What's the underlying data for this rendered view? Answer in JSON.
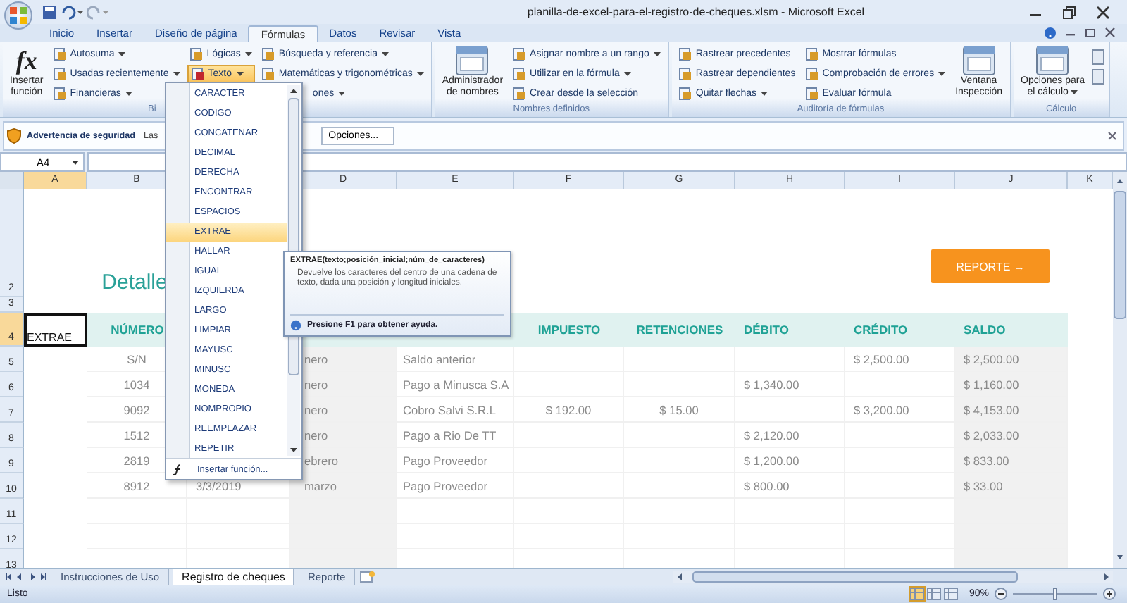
{
  "window": {
    "title": "planilla-de-excel-para-el-registro-de-cheques.xlsm - Microsoft Excel"
  },
  "ribbon_tabs": [
    {
      "label": "Inicio",
      "selected": false
    },
    {
      "label": "Insertar",
      "selected": false
    },
    {
      "label": "Diseño de página",
      "selected": false
    },
    {
      "label": "Fórmulas",
      "selected": true
    },
    {
      "label": "Datos",
      "selected": false
    },
    {
      "label": "Revisar",
      "selected": false
    },
    {
      "label": "Vista",
      "selected": false
    }
  ],
  "ribbon_groups": [
    {
      "label": "Bi",
      "columns": [
        [
          {
            "kind": "large",
            "lines": [
              "Insertar",
              "función"
            ],
            "glyph": "fx",
            "dropdown": false
          }
        ],
        [
          {
            "kind": "small",
            "label": "Autosuma",
            "dropdown": true,
            "open": false
          },
          {
            "kind": "small",
            "label": "Usadas recientemente",
            "dropdown": true,
            "open": false
          },
          {
            "kind": "small",
            "label": "Financieras",
            "dropdown": true,
            "open": false
          }
        ],
        [
          {
            "kind": "small",
            "label": "Lógicas",
            "dropdown": true,
            "open": false
          },
          {
            "kind": "small",
            "label": "Texto",
            "dropdown": true,
            "open": true
          }
        ],
        [
          {
            "kind": "small",
            "label": "Búsqueda y referencia",
            "dropdown": true,
            "open": false
          },
          {
            "kind": "small",
            "label": "Matemáticas y trigonométricas",
            "dropdown": true,
            "open": false
          },
          {
            "kind": "clipped",
            "label": "ones",
            "dropdown": true,
            "open": false
          }
        ]
      ]
    },
    {
      "label": "Nombres definidos",
      "columns": [
        [
          {
            "kind": "large",
            "lines": [
              "Administrador",
              "de nombres"
            ],
            "dropdown": false
          }
        ],
        [
          {
            "kind": "small",
            "label": "Asignar nombre a un rango",
            "dropdown": true,
            "open": false
          },
          {
            "kind": "small",
            "label": "Utilizar en la fórmula",
            "dropdown": true,
            "open": false
          },
          {
            "kind": "small",
            "label": "Crear desde la selección",
            "dropdown": false,
            "open": false
          }
        ]
      ]
    },
    {
      "label": "Auditoría de fórmulas",
      "columns": [
        [
          {
            "kind": "small",
            "label": "Rastrear precedentes",
            "dropdown": false,
            "open": false
          },
          {
            "kind": "small",
            "label": "Rastrear dependientes",
            "dropdown": false,
            "open": false
          },
          {
            "kind": "small",
            "label": "Quitar flechas",
            "dropdown": true,
            "open": false
          }
        ],
        [
          {
            "kind": "small",
            "label": "Mostrar fórmulas",
            "dropdown": false,
            "open": false
          },
          {
            "kind": "small",
            "label": "Comprobación de errores",
            "dropdown": true,
            "open": false
          },
          {
            "kind": "small",
            "label": "Evaluar fórmula",
            "dropdown": false,
            "open": false
          }
        ],
        [
          {
            "kind": "large",
            "lines": [
              "Ventana",
              "Inspección"
            ],
            "dropdown": false
          }
        ]
      ]
    },
    {
      "label": "Cálculo",
      "columns": [
        [
          {
            "kind": "large",
            "lines": [
              "Opciones para",
              "el cálculo"
            ],
            "dropdown": true
          }
        ],
        [
          {
            "kind": "icon"
          },
          {
            "kind": "icon"
          }
        ]
      ]
    }
  ],
  "security_bar": {
    "title": "Advertencia de seguridad",
    "message": "Las",
    "button": "Opciones..."
  },
  "formula_bar": {
    "name_box": "A4"
  },
  "sheet": {
    "columns": [
      {
        "label": "A",
        "selected": true
      },
      {
        "label": "B",
        "selected": false
      },
      {
        "label": "D",
        "selected": false
      },
      {
        "label": "E",
        "selected": false
      },
      {
        "label": "F",
        "selected": false
      },
      {
        "label": "G",
        "selected": false
      },
      {
        "label": "H",
        "selected": false
      },
      {
        "label": "I",
        "selected": false
      },
      {
        "label": "J",
        "selected": false
      },
      {
        "label": "K",
        "selected": false
      }
    ],
    "rows": [
      {
        "number": "2",
        "kind": "title",
        "selected": false,
        "B": "Detalle",
        "button": "REPORTE →"
      },
      {
        "number": "3",
        "kind": "spacer",
        "selected": false
      },
      {
        "number": "4",
        "kind": "header",
        "selected": true,
        "A": "EXTRAE",
        "B": "NÚMERO",
        "F": "IMPUESTO",
        "G": "RETENCIONES",
        "H": "DÉBITO",
        "I": "CRÉDITO",
        "J": "SALDO"
      },
      {
        "number": "5",
        "kind": "data",
        "selected": false,
        "B": "S/N",
        "D": "nero",
        "E": "Saldo anterior",
        "I": "$ 2,500.00",
        "J": "$ 2,500.00"
      },
      {
        "number": "6",
        "kind": "data",
        "selected": false,
        "B": "1034",
        "D": "nero",
        "E": "Pago a Minusca S.A",
        "H": "$ 1,340.00",
        "J": "$ 1,160.00"
      },
      {
        "number": "7",
        "kind": "data",
        "selected": false,
        "B": "9092",
        "D": "nero",
        "E": "Cobro Salvi S.R.L",
        "F": "$ 192.00",
        "G": "$ 15.00",
        "I": "$ 3,200.00",
        "J": "$ 4,153.00"
      },
      {
        "number": "8",
        "kind": "data",
        "selected": false,
        "B": "1512",
        "D": "nero",
        "E": "Pago a Rio De TT",
        "H": "$ 2,120.00",
        "J": "$ 2,033.00"
      },
      {
        "number": "9",
        "kind": "data",
        "selected": false,
        "B": "2819",
        "D": "ebrero",
        "E": "Pago Proveedor",
        "H": "$ 1,200.00",
        "J": "$ 833.00"
      },
      {
        "number": "10",
        "kind": "data",
        "selected": false,
        "B": "8912",
        "C": "3/3/2019",
        "D": "marzo",
        "E": "Pago Proveedor",
        "H": "$ 800.00",
        "J": "$ 33.00"
      },
      {
        "number": "11",
        "kind": "data",
        "selected": false
      },
      {
        "number": "12",
        "kind": "data",
        "selected": false
      },
      {
        "number": "13",
        "kind": "data",
        "selected": false
      }
    ]
  },
  "function_menu": {
    "items": [
      {
        "label": "CARACTER",
        "selected": false
      },
      {
        "label": "CODIGO",
        "selected": false
      },
      {
        "label": "CONCATENAR",
        "selected": false
      },
      {
        "label": "DECIMAL",
        "selected": false
      },
      {
        "label": "DERECHA",
        "selected": false
      },
      {
        "label": "ENCONTRAR",
        "selected": false
      },
      {
        "label": "ESPACIOS",
        "selected": false
      },
      {
        "label": "EXTRAE",
        "selected": true
      },
      {
        "label": "HALLAR",
        "selected": false
      },
      {
        "label": "IGUAL",
        "selected": false
      },
      {
        "label": "IZQUIERDA",
        "selected": false
      },
      {
        "label": "LARGO",
        "selected": false
      },
      {
        "label": "LIMPIAR",
        "selected": false
      },
      {
        "label": "MAYUSC",
        "selected": false
      },
      {
        "label": "MINUSC",
        "selected": false
      },
      {
        "label": "MONEDA",
        "selected": false
      },
      {
        "label": "NOMPROPIO",
        "selected": false
      },
      {
        "label": "REEMPLAZAR",
        "selected": false
      },
      {
        "label": "REPETIR",
        "selected": false
      }
    ],
    "footer": "Insertar función..."
  },
  "tooltip": {
    "title": "EXTRAE(texto;posición_inicial;núm_de_caracteres)",
    "body": "Devuelve los caracteres del centro de una cadena de texto, dada una posición y longitud iniciales.",
    "help": "Presione F1 para obtener ayuda."
  },
  "sheet_tabs": [
    {
      "label": "Instrucciones de Uso",
      "selected": false
    },
    {
      "label": "Registro de cheques",
      "selected": true
    },
    {
      "label": "Reporte",
      "selected": false
    }
  ],
  "status_bar": {
    "text": "Listo",
    "views": [
      {
        "selected": true
      },
      {
        "selected": false
      },
      {
        "selected": false
      }
    ],
    "zoom": "90%",
    "zoom_slider": {
      "level": 0.5
    }
  }
}
